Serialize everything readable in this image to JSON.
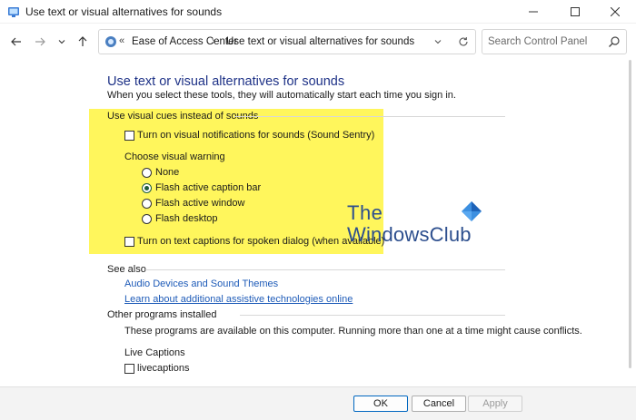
{
  "window": {
    "title": "Use text or visual alternatives for sounds",
    "controls": {
      "minimize": "minimize-icon",
      "maximize": "maximize-icon",
      "close": "close-icon"
    }
  },
  "nav": {
    "breadcrumb_chevron": "«",
    "crumbs": [
      "Ease of Access Center",
      "Use text or visual alternatives for sounds"
    ],
    "separator": "›",
    "search_placeholder": "Search Control Panel"
  },
  "page": {
    "title": "Use text or visual alternatives for sounds",
    "subtitle": "When you select these tools, they will automatically start each time you sign in."
  },
  "visual_cues": {
    "heading": "Use visual cues instead of sounds",
    "sound_sentry": {
      "label": "Turn on visual notifications for sounds (Sound Sentry)",
      "checked": false
    },
    "choose_heading": "Choose visual warning",
    "options": [
      {
        "label": "None",
        "selected": false
      },
      {
        "label": "Flash active caption bar",
        "selected": true
      },
      {
        "label": "Flash active window",
        "selected": false
      },
      {
        "label": "Flash desktop",
        "selected": false
      }
    ],
    "text_captions": {
      "label": "Turn on text captions for spoken dialog (when available)",
      "checked": false
    }
  },
  "see_also": {
    "heading": "See also",
    "links": [
      "Audio Devices and Sound Themes",
      "Learn about additional assistive technologies online"
    ]
  },
  "other_programs": {
    "heading": "Other programs installed",
    "note": "These programs are available on this computer. Running more than one at a time might cause conflicts.",
    "group_label": "Live Captions",
    "item": {
      "label": "livecaptions",
      "checked": false
    }
  },
  "watermark": {
    "line1": "The",
    "line2": "WindowsClub"
  },
  "footer": {
    "ok": "OK",
    "cancel": "Cancel",
    "apply": "Apply"
  },
  "colors": {
    "highlight": "#fff65c",
    "title_blue": "#1e3287",
    "link_blue": "#1e5bb8",
    "radio_green": "#1f5c3a"
  }
}
